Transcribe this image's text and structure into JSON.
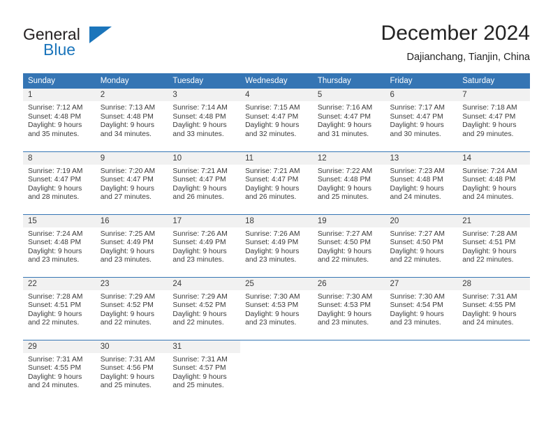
{
  "brand": {
    "name_part1": "General",
    "name_part2": "Blue",
    "accent_color": "#1b75bb",
    "logo_icon": "triangle-flag-icon"
  },
  "header": {
    "title": "December 2024",
    "subtitle": "Dajianchang, Tianjin, China"
  },
  "theme": {
    "header_bg": "#3575b4",
    "daynum_bg": "#f1f1f1",
    "text_color": "#3a3a3a",
    "row_divider": "#3575b4"
  },
  "weekday_headers": [
    "Sunday",
    "Monday",
    "Tuesday",
    "Wednesday",
    "Thursday",
    "Friday",
    "Saturday"
  ],
  "weeks": [
    [
      {
        "day": "1",
        "sunrise": "Sunrise: 7:12 AM",
        "sunset": "Sunset: 4:48 PM",
        "daylight_line1": "Daylight: 9 hours",
        "daylight_line2": "and 35 minutes."
      },
      {
        "day": "2",
        "sunrise": "Sunrise: 7:13 AM",
        "sunset": "Sunset: 4:48 PM",
        "daylight_line1": "Daylight: 9 hours",
        "daylight_line2": "and 34 minutes."
      },
      {
        "day": "3",
        "sunrise": "Sunrise: 7:14 AM",
        "sunset": "Sunset: 4:48 PM",
        "daylight_line1": "Daylight: 9 hours",
        "daylight_line2": "and 33 minutes."
      },
      {
        "day": "4",
        "sunrise": "Sunrise: 7:15 AM",
        "sunset": "Sunset: 4:47 PM",
        "daylight_line1": "Daylight: 9 hours",
        "daylight_line2": "and 32 minutes."
      },
      {
        "day": "5",
        "sunrise": "Sunrise: 7:16 AM",
        "sunset": "Sunset: 4:47 PM",
        "daylight_line1": "Daylight: 9 hours",
        "daylight_line2": "and 31 minutes."
      },
      {
        "day": "6",
        "sunrise": "Sunrise: 7:17 AM",
        "sunset": "Sunset: 4:47 PM",
        "daylight_line1": "Daylight: 9 hours",
        "daylight_line2": "and 30 minutes."
      },
      {
        "day": "7",
        "sunrise": "Sunrise: 7:18 AM",
        "sunset": "Sunset: 4:47 PM",
        "daylight_line1": "Daylight: 9 hours",
        "daylight_line2": "and 29 minutes."
      }
    ],
    [
      {
        "day": "8",
        "sunrise": "Sunrise: 7:19 AM",
        "sunset": "Sunset: 4:47 PM",
        "daylight_line1": "Daylight: 9 hours",
        "daylight_line2": "and 28 minutes."
      },
      {
        "day": "9",
        "sunrise": "Sunrise: 7:20 AM",
        "sunset": "Sunset: 4:47 PM",
        "daylight_line1": "Daylight: 9 hours",
        "daylight_line2": "and 27 minutes."
      },
      {
        "day": "10",
        "sunrise": "Sunrise: 7:21 AM",
        "sunset": "Sunset: 4:47 PM",
        "daylight_line1": "Daylight: 9 hours",
        "daylight_line2": "and 26 minutes."
      },
      {
        "day": "11",
        "sunrise": "Sunrise: 7:21 AM",
        "sunset": "Sunset: 4:47 PM",
        "daylight_line1": "Daylight: 9 hours",
        "daylight_line2": "and 26 minutes."
      },
      {
        "day": "12",
        "sunrise": "Sunrise: 7:22 AM",
        "sunset": "Sunset: 4:48 PM",
        "daylight_line1": "Daylight: 9 hours",
        "daylight_line2": "and 25 minutes."
      },
      {
        "day": "13",
        "sunrise": "Sunrise: 7:23 AM",
        "sunset": "Sunset: 4:48 PM",
        "daylight_line1": "Daylight: 9 hours",
        "daylight_line2": "and 24 minutes."
      },
      {
        "day": "14",
        "sunrise": "Sunrise: 7:24 AM",
        "sunset": "Sunset: 4:48 PM",
        "daylight_line1": "Daylight: 9 hours",
        "daylight_line2": "and 24 minutes."
      }
    ],
    [
      {
        "day": "15",
        "sunrise": "Sunrise: 7:24 AM",
        "sunset": "Sunset: 4:48 PM",
        "daylight_line1": "Daylight: 9 hours",
        "daylight_line2": "and 23 minutes."
      },
      {
        "day": "16",
        "sunrise": "Sunrise: 7:25 AM",
        "sunset": "Sunset: 4:49 PM",
        "daylight_line1": "Daylight: 9 hours",
        "daylight_line2": "and 23 minutes."
      },
      {
        "day": "17",
        "sunrise": "Sunrise: 7:26 AM",
        "sunset": "Sunset: 4:49 PM",
        "daylight_line1": "Daylight: 9 hours",
        "daylight_line2": "and 23 minutes."
      },
      {
        "day": "18",
        "sunrise": "Sunrise: 7:26 AM",
        "sunset": "Sunset: 4:49 PM",
        "daylight_line1": "Daylight: 9 hours",
        "daylight_line2": "and 23 minutes."
      },
      {
        "day": "19",
        "sunrise": "Sunrise: 7:27 AM",
        "sunset": "Sunset: 4:50 PM",
        "daylight_line1": "Daylight: 9 hours",
        "daylight_line2": "and 22 minutes."
      },
      {
        "day": "20",
        "sunrise": "Sunrise: 7:27 AM",
        "sunset": "Sunset: 4:50 PM",
        "daylight_line1": "Daylight: 9 hours",
        "daylight_line2": "and 22 minutes."
      },
      {
        "day": "21",
        "sunrise": "Sunrise: 7:28 AM",
        "sunset": "Sunset: 4:51 PM",
        "daylight_line1": "Daylight: 9 hours",
        "daylight_line2": "and 22 minutes."
      }
    ],
    [
      {
        "day": "22",
        "sunrise": "Sunrise: 7:28 AM",
        "sunset": "Sunset: 4:51 PM",
        "daylight_line1": "Daylight: 9 hours",
        "daylight_line2": "and 22 minutes."
      },
      {
        "day": "23",
        "sunrise": "Sunrise: 7:29 AM",
        "sunset": "Sunset: 4:52 PM",
        "daylight_line1": "Daylight: 9 hours",
        "daylight_line2": "and 22 minutes."
      },
      {
        "day": "24",
        "sunrise": "Sunrise: 7:29 AM",
        "sunset": "Sunset: 4:52 PM",
        "daylight_line1": "Daylight: 9 hours",
        "daylight_line2": "and 22 minutes."
      },
      {
        "day": "25",
        "sunrise": "Sunrise: 7:30 AM",
        "sunset": "Sunset: 4:53 PM",
        "daylight_line1": "Daylight: 9 hours",
        "daylight_line2": "and 23 minutes."
      },
      {
        "day": "26",
        "sunrise": "Sunrise: 7:30 AM",
        "sunset": "Sunset: 4:53 PM",
        "daylight_line1": "Daylight: 9 hours",
        "daylight_line2": "and 23 minutes."
      },
      {
        "day": "27",
        "sunrise": "Sunrise: 7:30 AM",
        "sunset": "Sunset: 4:54 PM",
        "daylight_line1": "Daylight: 9 hours",
        "daylight_line2": "and 23 minutes."
      },
      {
        "day": "28",
        "sunrise": "Sunrise: 7:31 AM",
        "sunset": "Sunset: 4:55 PM",
        "daylight_line1": "Daylight: 9 hours",
        "daylight_line2": "and 24 minutes."
      }
    ],
    [
      {
        "day": "29",
        "sunrise": "Sunrise: 7:31 AM",
        "sunset": "Sunset: 4:55 PM",
        "daylight_line1": "Daylight: 9 hours",
        "daylight_line2": "and 24 minutes."
      },
      {
        "day": "30",
        "sunrise": "Sunrise: 7:31 AM",
        "sunset": "Sunset: 4:56 PM",
        "daylight_line1": "Daylight: 9 hours",
        "daylight_line2": "and 25 minutes."
      },
      {
        "day": "31",
        "sunrise": "Sunrise: 7:31 AM",
        "sunset": "Sunset: 4:57 PM",
        "daylight_line1": "Daylight: 9 hours",
        "daylight_line2": "and 25 minutes."
      },
      {
        "day": "",
        "sunrise": "",
        "sunset": "",
        "daylight_line1": "",
        "daylight_line2": ""
      },
      {
        "day": "",
        "sunrise": "",
        "sunset": "",
        "daylight_line1": "",
        "daylight_line2": ""
      },
      {
        "day": "",
        "sunrise": "",
        "sunset": "",
        "daylight_line1": "",
        "daylight_line2": ""
      },
      {
        "day": "",
        "sunrise": "",
        "sunset": "",
        "daylight_line1": "",
        "daylight_line2": ""
      }
    ]
  ]
}
